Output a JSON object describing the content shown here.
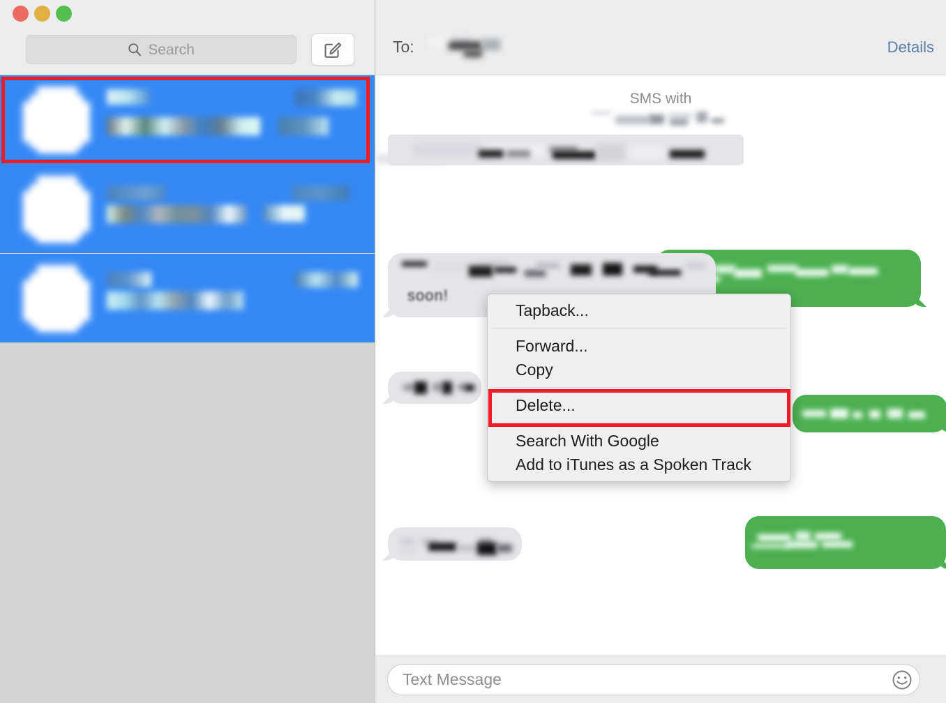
{
  "window": {
    "traffic_lights": [
      "close",
      "minimize",
      "maximize"
    ],
    "colors": {
      "selection_blue": "#3689f5",
      "sent_green": "#4cb050",
      "received_grey": "#e4e4e9",
      "annotation_red": "#ee1c24",
      "link_blue": "#5d7ca6",
      "chrome_grey": "#ececec",
      "sidebar_empty": "#d4d4d4"
    }
  },
  "sidebar": {
    "search": {
      "placeholder": "Search",
      "value": "",
      "icon": "search-icon"
    },
    "compose": {
      "icon": "compose-icon",
      "label": ""
    },
    "conversations": [
      {
        "name_redacted": true,
        "preview_redacted": true,
        "time_redacted": true,
        "selected": true,
        "highlighted": true
      },
      {
        "name_redacted": true,
        "preview_redacted": true,
        "time_redacted": true,
        "selected": true,
        "highlighted": false
      },
      {
        "name_redacted": true,
        "preview_redacted": true,
        "time_redacted": true,
        "selected": true,
        "highlighted": false
      }
    ]
  },
  "header": {
    "to_label": "To:",
    "recipient": "",
    "recipient_redacted": true,
    "details_label": "Details"
  },
  "thread": {
    "service_label": "SMS with",
    "service_sub_redacted": true,
    "messages": [
      {
        "id": "m1",
        "side": "received",
        "text": "",
        "redacted": true
      },
      {
        "id": "m2",
        "side": "sent",
        "text": "",
        "redacted": true
      },
      {
        "id": "m3",
        "side": "received",
        "text": "",
        "redacted": true,
        "partial_text": "soon!",
        "context_menu_target": true
      },
      {
        "id": "m4",
        "side": "sent",
        "text": "",
        "redacted": true
      },
      {
        "id": "m5",
        "side": "received",
        "text": "",
        "redacted": true
      },
      {
        "id": "m6",
        "side": "sent",
        "text": "",
        "redacted": true
      },
      {
        "id": "m7",
        "side": "received",
        "text": "",
        "redacted": true
      }
    ]
  },
  "context_menu": {
    "items": [
      {
        "label": "Tapback...",
        "separator_after": true
      },
      {
        "label": "Forward...",
        "separator_after": false
      },
      {
        "label": "Copy",
        "separator_after": true
      },
      {
        "label": "Delete...",
        "separator_after": true,
        "highlighted": true
      },
      {
        "label": "Search With Google",
        "separator_after": false
      },
      {
        "label": "Add to iTunes as a Spoken Track",
        "separator_after": false
      }
    ]
  },
  "composer": {
    "placeholder": "Text Message",
    "value": "",
    "emoji_button_icon": "smiley-icon"
  },
  "annotations": [
    {
      "name": "conversation-highlight",
      "target": "first conversation row",
      "color": "#ee1c24"
    },
    {
      "name": "delete-highlight",
      "target": "Delete... menu item",
      "color": "#ee1c24"
    }
  ]
}
